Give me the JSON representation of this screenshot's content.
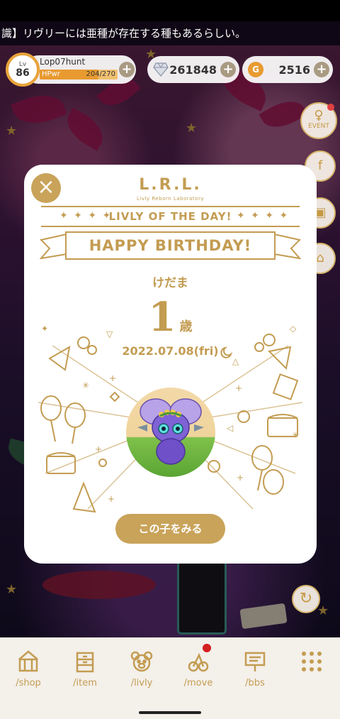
{
  "ticker": {
    "text": "識】リヴリーには亜種が存在する種もあるらしい。"
  },
  "hud": {
    "level_label": "Lv",
    "level": "86",
    "username": "Lop07hunt",
    "hp_label": "HPwr",
    "hp_value": "204/270",
    "hp_fraction": 0.7556,
    "diamonds": "261848",
    "gold": "2516",
    "plus": "+"
  },
  "side": {
    "event_label": "EVENT"
  },
  "modal": {
    "logo": "L.R.L.",
    "logo_sub": "Livly Reborn Laboratory",
    "deco_left": "✦ ✦ ✦ ✦",
    "deco_right": "✦ ✦ ✦ ✦",
    "section_title": "LIVLY OF THE DAY!",
    "banner": "HAPPY BIRTHDAY!",
    "livly_name": "けだま",
    "age": "1",
    "age_unit": "歳",
    "birthday": "2022.07.08(fri)",
    "see_button": "この子をみる",
    "close": "×"
  },
  "nav": {
    "items": [
      {
        "label": "/shop",
        "icon": "shop-icon"
      },
      {
        "label": "/item",
        "icon": "drawer-icon"
      },
      {
        "label": "/livly",
        "icon": "bear-icon"
      },
      {
        "label": "/move",
        "icon": "move-icon"
      },
      {
        "label": "/bbs",
        "icon": "bbs-icon"
      },
      {
        "label": "",
        "icon": "grid-menu-icon"
      }
    ]
  },
  "colors": {
    "gold": "#c39c52",
    "button": "#c9a35a",
    "hp": "#e89a30",
    "notify": "#d42020"
  }
}
